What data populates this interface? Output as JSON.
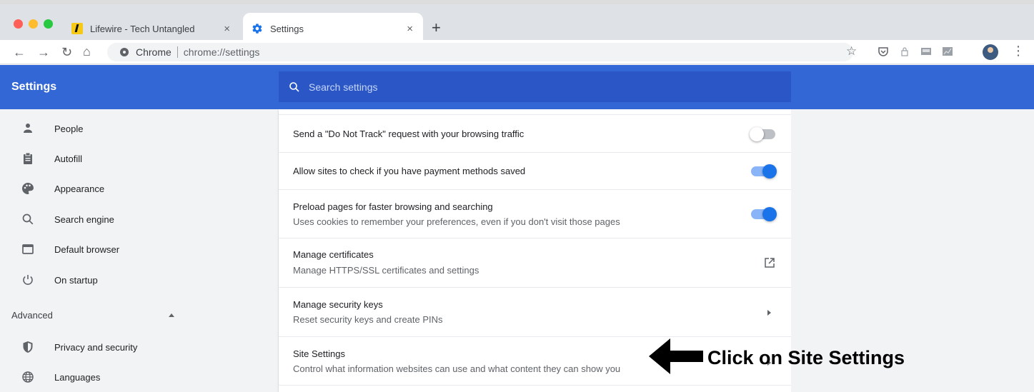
{
  "browser": {
    "tabs": [
      {
        "title": "Lifewire - Tech Untangled",
        "icon": "lifewire-favicon",
        "active": false
      },
      {
        "title": "Settings",
        "icon": "gear-icon",
        "active": true
      }
    ],
    "close_glyph": "×",
    "new_tab_glyph": "+",
    "address": {
      "chip": "Chrome",
      "url": "chrome://settings"
    }
  },
  "header": {
    "title": "Settings",
    "search_placeholder": "Search settings",
    "color": "#3367d6"
  },
  "sidebar": {
    "items": [
      {
        "label": "People",
        "icon": "person-icon"
      },
      {
        "label": "Autofill",
        "icon": "clipboard-icon"
      },
      {
        "label": "Appearance",
        "icon": "palette-icon"
      },
      {
        "label": "Search engine",
        "icon": "search-icon"
      },
      {
        "label": "Default browser",
        "icon": "browser-window-icon"
      },
      {
        "label": "On startup",
        "icon": "power-icon"
      }
    ],
    "advanced_label": "Advanced",
    "advanced_items": [
      {
        "label": "Privacy and security",
        "icon": "shield-icon"
      },
      {
        "label": "Languages",
        "icon": "globe-icon"
      }
    ]
  },
  "settings_rows": [
    {
      "title": "Send a \"Do Not Track\" request with your browsing traffic",
      "subtitle": "",
      "control": "toggle",
      "enabled": false
    },
    {
      "title": "Allow sites to check if you have payment methods saved",
      "subtitle": "",
      "control": "toggle",
      "enabled": true
    },
    {
      "title": "Preload pages for faster browsing and searching",
      "subtitle": "Uses cookies to remember your preferences, even if you don't visit those pages",
      "control": "toggle",
      "enabled": true
    },
    {
      "title": "Manage certificates",
      "subtitle": "Manage HTTPS/SSL certificates and settings",
      "control": "external-link-icon"
    },
    {
      "title": "Manage security keys",
      "subtitle": "Reset security keys and create PINs",
      "control": "chevron-right-icon"
    },
    {
      "title": "Site Settings",
      "subtitle": "Control what information websites can use and what content they can show you",
      "control": "chevron-right-icon"
    }
  ],
  "annotation": {
    "text": "Click on Site Settings"
  },
  "colors": {
    "accent": "#1a73e8",
    "header": "#3367d6",
    "search_box": "#2a56c6"
  }
}
